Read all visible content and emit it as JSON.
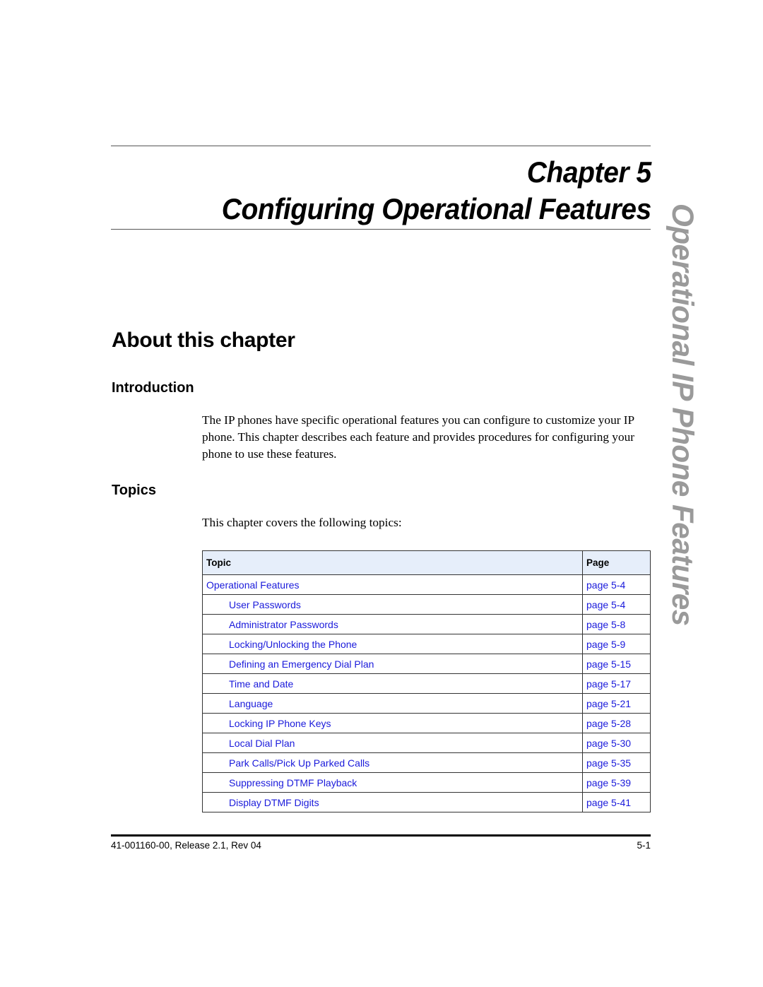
{
  "header": {
    "chapter_line": "Chapter 5",
    "title_line": "Configuring Operational Features",
    "side_tab": "Operational IP Phone Features"
  },
  "sections": {
    "about": "About this chapter",
    "introduction": {
      "heading": "Introduction",
      "body": "The IP phones have specific operational features you can configure to customize your IP phone. This chapter describes each feature and provides procedures for configuring your phone to use these features."
    },
    "topics": {
      "heading": "Topics",
      "body": "This chapter covers the following topics:"
    }
  },
  "table": {
    "columns": [
      "Topic",
      "Page"
    ],
    "rows": [
      {
        "topic": "Operational Features",
        "page": "page 5-4",
        "indent": false
      },
      {
        "topic": "User Passwords",
        "page": "page 5-4",
        "indent": true
      },
      {
        "topic": "Administrator Passwords",
        "page": "page 5-8",
        "indent": true
      },
      {
        "topic": "Locking/Unlocking the Phone",
        "page": "page 5-9",
        "indent": true
      },
      {
        "topic": "Defining an Emergency Dial Plan",
        "page": "page 5-15",
        "indent": true
      },
      {
        "topic": "Time and Date",
        "page": "page 5-17",
        "indent": true
      },
      {
        "topic": "Language",
        "page": "page 5-21",
        "indent": true
      },
      {
        "topic": "Locking IP Phone Keys",
        "page": "page 5-28",
        "indent": true
      },
      {
        "topic": "Local Dial Plan",
        "page": "page 5-30",
        "indent": true
      },
      {
        "topic": "Park Calls/Pick Up Parked Calls",
        "page": "page 5-35",
        "indent": true
      },
      {
        "topic": "Suppressing DTMF Playback",
        "page": "page 5-39",
        "indent": true
      },
      {
        "topic": "Display DTMF Digits",
        "page": "page 5-41",
        "indent": true
      }
    ]
  },
  "footer": {
    "doc_id": "41-001160-00, Release 2.1, Rev 04",
    "page_number": "5-1"
  },
  "colors": {
    "link": "#1a1adb",
    "header_row_bg": "#e6eefa",
    "side_tab": "#9a9a9a"
  }
}
